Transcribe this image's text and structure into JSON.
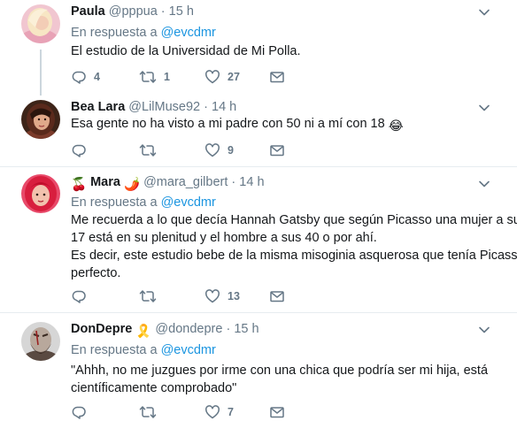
{
  "tweets": [
    {
      "name": "Paula",
      "handle": "@pppua",
      "dot": "·",
      "time": "15 h",
      "reply_prefix": "En respuesta a",
      "reply_mention": "@evcdmr",
      "lines": [
        "El estudio de la Universidad de Mi Polla."
      ],
      "replies": "4",
      "retweets": "1",
      "likes": "27"
    },
    {
      "name": "Bea Lara",
      "handle": "@LilMuse92",
      "dot": "·",
      "time": "14 h",
      "lines": [
        "Esa gente no ha visto a mi padre con 50 ni a mí con 18"
      ],
      "line_emoji": "😂",
      "replies": "",
      "retweets": "",
      "likes": "9"
    },
    {
      "name": "Mara",
      "name_emoji_left": "🍒",
      "name_emoji_right": "🌶️",
      "handle": "@mara_gilbert",
      "dot": "·",
      "time": "14 h",
      "reply_prefix": "En respuesta a",
      "reply_mention": "@evcdmr",
      "lines": [
        "Me recuerda a lo que decía Hannah Gatsby que según Picasso una mujer a sus",
        "17 está en su plenitud y el hombre a sus 40 o por ahí.",
        "Es decir, este estudio bebe de la misma misoginia asquerosa que tenía Picasso,",
        "perfecto."
      ],
      "replies": "",
      "retweets": "",
      "likes": "13"
    },
    {
      "name": "DonDepre",
      "name_emoji_right": "🎗️",
      "handle": "@dondepre",
      "dot": "·",
      "time": "15 h",
      "reply_prefix": "En respuesta a",
      "reply_mention": "@evcdmr",
      "lines": [
        "\"Ahhh, no me juzgues por irme con una chica que podría ser mi hija, está",
        "científicamente comprobado\""
      ],
      "replies": "",
      "retweets": "",
      "likes": "7"
    }
  ],
  "icons": {
    "reply": "reply-icon",
    "retweet": "retweet-icon",
    "like": "like-icon",
    "message": "message-icon",
    "caret": "chevron-down-icon"
  },
  "colors": {
    "mention": "#1b95e0",
    "secondary": "#657786",
    "text": "#14171a",
    "divider": "#e6ecf0",
    "thread_line": "#ccd6dd"
  }
}
